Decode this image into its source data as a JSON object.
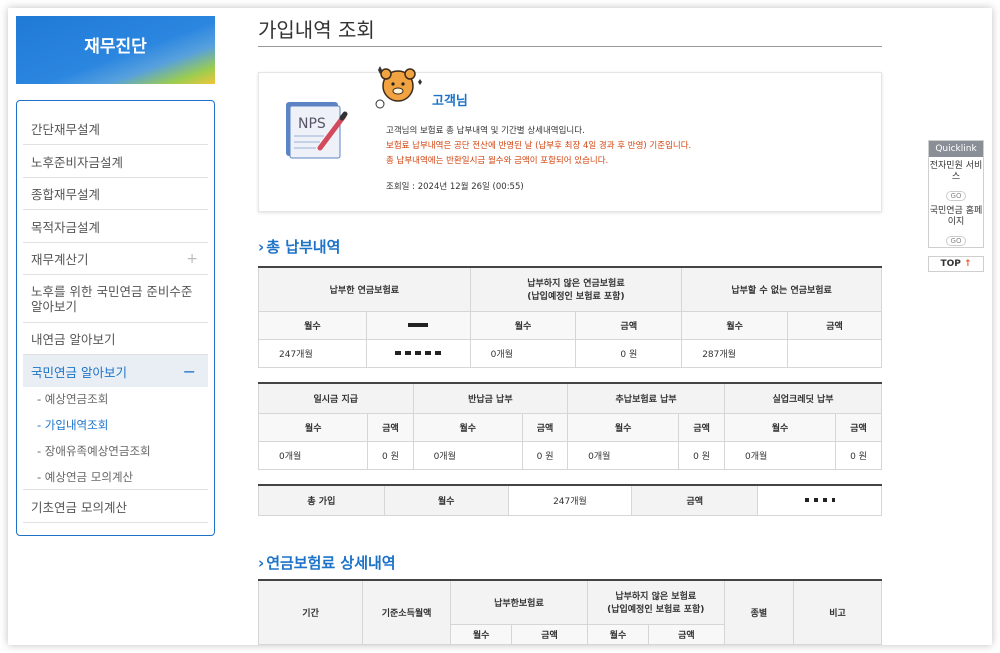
{
  "sidebar": {
    "brand": "재무진단",
    "items": [
      {
        "label": "간단재무설계"
      },
      {
        "label": "노후준비자금설계"
      },
      {
        "label": "종합재무설계"
      },
      {
        "label": "목적자금설계"
      },
      {
        "label": "재무계산기",
        "toggle": "+"
      },
      {
        "label": "노후를 위한 국민연금 준비수준 알아보기"
      },
      {
        "label": "내연금 알아보기"
      },
      {
        "label": "국민연금 알아보기",
        "toggle": "−"
      },
      {
        "label": "기초연금 모의계산"
      }
    ],
    "sub_items": [
      {
        "label": "- 예상연금조회"
      },
      {
        "label": "- 가입내역조회"
      },
      {
        "label": "- 장애유족예상연금조회"
      },
      {
        "label": "- 예상연금 모의계산"
      }
    ]
  },
  "main": {
    "title": "가입내역 조회",
    "info": {
      "nps_label": "NPS",
      "customer": "고객님",
      "line1": "고객님의 보험료 총 납부내역 및 기간별 상세내역입니다.",
      "line2": "보험료 납부내역은 공단 전산에 반영된 날 (납부후 최장 4일 경과 후 반영) 기준입니다.",
      "line3": "총 납부내역에는 반환일시금 월수와 금액이 포함되어 있습니다.",
      "line4": "조회일 : 2024년 12월 26일 (00:55)"
    },
    "section1": {
      "heading": "총 납부내역",
      "arrow": "›",
      "table1": {
        "h_paid": "납부한 연금보험료",
        "h_unpaid": "납부하지 않은 연금보험료",
        "h_unpaid_sub": "(납입예정인 보험료 포함)",
        "h_cannot": "납부할 수 없는 연금보험료",
        "col_months": "월수",
        "col_amount": "금액",
        "paid_months": "247개월",
        "unpaid_months": "0개월",
        "unpaid_amount": "0 원",
        "cannot_months": "287개월"
      },
      "table2": {
        "headers": [
          "일시금 지급",
          "반납금 납부",
          "추납보험료 납부",
          "실업크레딧 납부"
        ],
        "col_months": "월수",
        "col_amount": "금액",
        "values": [
          {
            "months": "0개월",
            "amount": "0 원"
          },
          {
            "months": "0개월",
            "amount": "0 원"
          },
          {
            "months": "0개월",
            "amount": "0 원"
          },
          {
            "months": "0개월",
            "amount": "0 원"
          }
        ]
      },
      "table3": {
        "label": "총 가입",
        "col_months": "월수",
        "months": "247개월",
        "col_amount": "금액"
      }
    },
    "section2": {
      "heading": "연금보험료 상세내역",
      "arrow": "›",
      "headers": {
        "period": "기간",
        "income": "기준소득월액",
        "paid": "납부한보험료",
        "unpaid": "납부하지 않은 보험료",
        "unpaid_sub": "(납입예정인 보험료 포함)",
        "type": "종별",
        "note": "비고",
        "months": "월수",
        "amount": "금액"
      }
    }
  },
  "quicklink": {
    "title": "Quicklink",
    "item1": "전자민원 서비스",
    "item2": "국민연금 홈페이지",
    "go": "GO",
    "top": "TOP"
  }
}
